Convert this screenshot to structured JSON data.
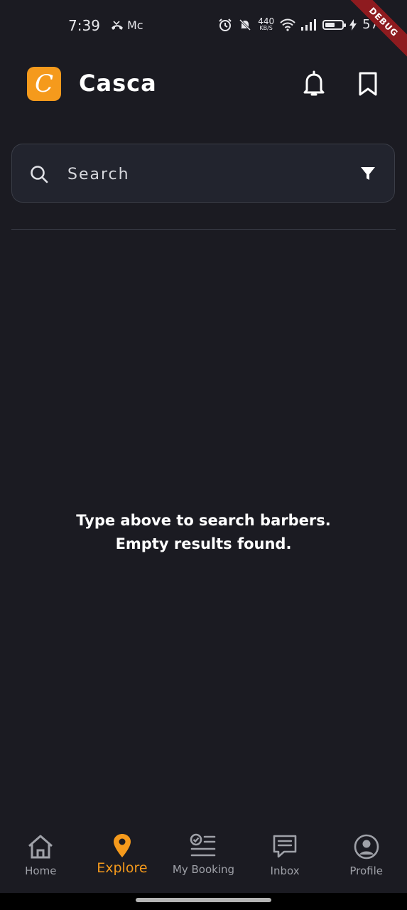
{
  "status_bar": {
    "time": "7:39",
    "carrier": "Mc",
    "net_speed": "440",
    "net_unit": "KB/S",
    "battery_percent": "57",
    "battery_level": 0.57
  },
  "debug_banner": "DEBUG",
  "header": {
    "logo_letter": "C",
    "title": "Casca"
  },
  "search": {
    "placeholder": "Search"
  },
  "empty_state": {
    "line1": "Type above to search barbers.",
    "line2": "Empty results found."
  },
  "nav": {
    "items": [
      {
        "label": "Home",
        "icon": "home-icon"
      },
      {
        "label": "Explore",
        "icon": "location-pin-icon",
        "active": true
      },
      {
        "label": "My Booking",
        "icon": "booking-list-icon"
      },
      {
        "label": "Inbox",
        "icon": "chat-icon"
      },
      {
        "label": "Profile",
        "icon": "profile-icon"
      }
    ]
  },
  "colors": {
    "accent": "#f59a1c",
    "background": "#1b1b22",
    "nav_inactive": "#9fa1a8"
  }
}
